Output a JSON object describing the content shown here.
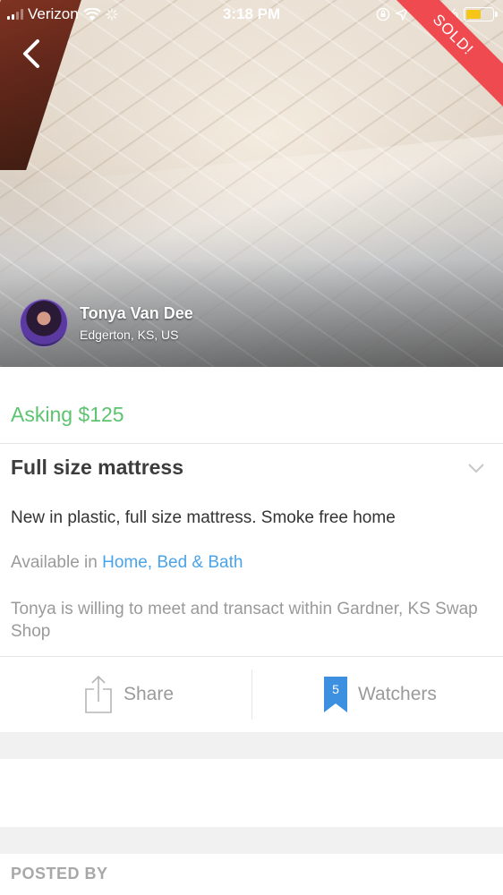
{
  "status_bar": {
    "carrier": "Verizon",
    "time": "3:18 PM",
    "battery_percent": "57%",
    "battery_level": 0.57,
    "battery_color": "#f5c518"
  },
  "hero": {
    "sold_label": "SOLD!",
    "sold_color": "#ef4a50",
    "back_icon": "chevron-left-icon"
  },
  "seller": {
    "name": "Tonya Van Dee",
    "location": "Edgerton, KS, US"
  },
  "listing": {
    "price": "Asking $125",
    "price_color": "#5cc36f",
    "title": "Full size mattress",
    "description": "New in plastic, full size mattress.  Smoke free home",
    "available_prefix": "Available in",
    "category": "Home, Bed & Bath",
    "category_color": "#4aa3e8",
    "meet_text": "Tonya is willing to meet and transact within Gardner, KS Swap Shop"
  },
  "actions": {
    "share_label": "Share",
    "watchers_label": "Watchers",
    "watchers_count": "5",
    "watchers_color": "#3d8fe0"
  },
  "sections": {
    "posted_by": "POSTED BY"
  }
}
